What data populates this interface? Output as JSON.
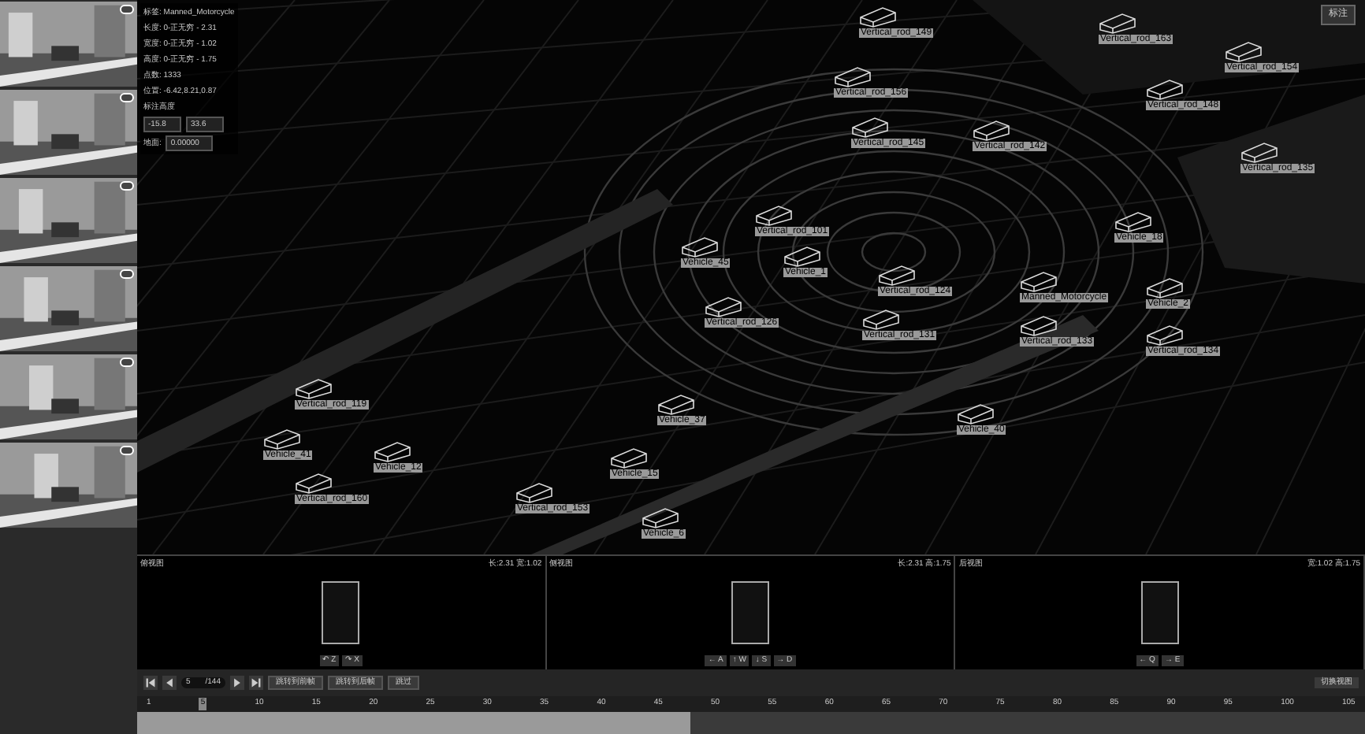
{
  "info": {
    "rows": [
      "标签: Manned_Motorcycle",
      "长度: 0-正无穷 - 2.31",
      "宽度: 0-正无穷 - 1.02",
      "高度: 0-正无穷 - 1.75",
      "点数: 1333",
      "位置: -6.42,8.21,0.87",
      "标注高度"
    ],
    "min": "-15.8",
    "max": "33.6",
    "ground_label": "地面:",
    "ground": "0.00000"
  },
  "top_button": "标注",
  "objects": [
    "Vertical_rod_149",
    "Vertical_rod_163",
    "Vertical_rod_154",
    "Vertical_rod_156",
    "Vertical_rod_148",
    "Vertical_rod_145",
    "Vertical_rod_142",
    "Vertical_rod_135",
    "Vertical_rod_101",
    "Vehicle_18",
    "Vehicle_45",
    "Vehicle_1",
    "Vertical_rod_124",
    "Manned_Motorcycle",
    "Vehicle_2",
    "Vertical_rod_126",
    "Vertical_rod_131",
    "Vertical_rod_133",
    "Vertical_rod_134",
    "Vertical_rod_119",
    "Vehicle_37",
    "Vehicle_40",
    "Vehicle_41",
    "Vehicle_12",
    "Vehicle_15",
    "Vertical_rod_160",
    "Vertical_rod_153",
    "Vehicle_6"
  ],
  "views": [
    {
      "title": "俯视图",
      "dims": "长:2.31 宽:1.02",
      "keys": [
        "↶ Z",
        "↷ X"
      ]
    },
    {
      "title": "侧视图",
      "dims": "长:2.31 高:1.75",
      "keys": [
        "← A",
        "↑ W",
        "↓ S",
        "→ D"
      ]
    },
    {
      "title": "后视图",
      "dims": "宽:1.02 高:1.75",
      "keys": [
        "← Q",
        "→ E"
      ]
    }
  ],
  "toolbar": {
    "frame": "5",
    "total": "/144",
    "buttons": [
      "跳转到前帧",
      "跳转到后帧",
      "跳过"
    ],
    "right_button": "切换视图"
  },
  "timeline": {
    "ticks": [
      "1",
      "10",
      "15",
      "20",
      "25",
      "30",
      "35",
      "40",
      "45",
      "50",
      "55",
      "60",
      "65",
      "70",
      "75",
      "80",
      "85",
      "90",
      "95",
      "100",
      "105"
    ],
    "current": "5",
    "level": 0.45
  }
}
